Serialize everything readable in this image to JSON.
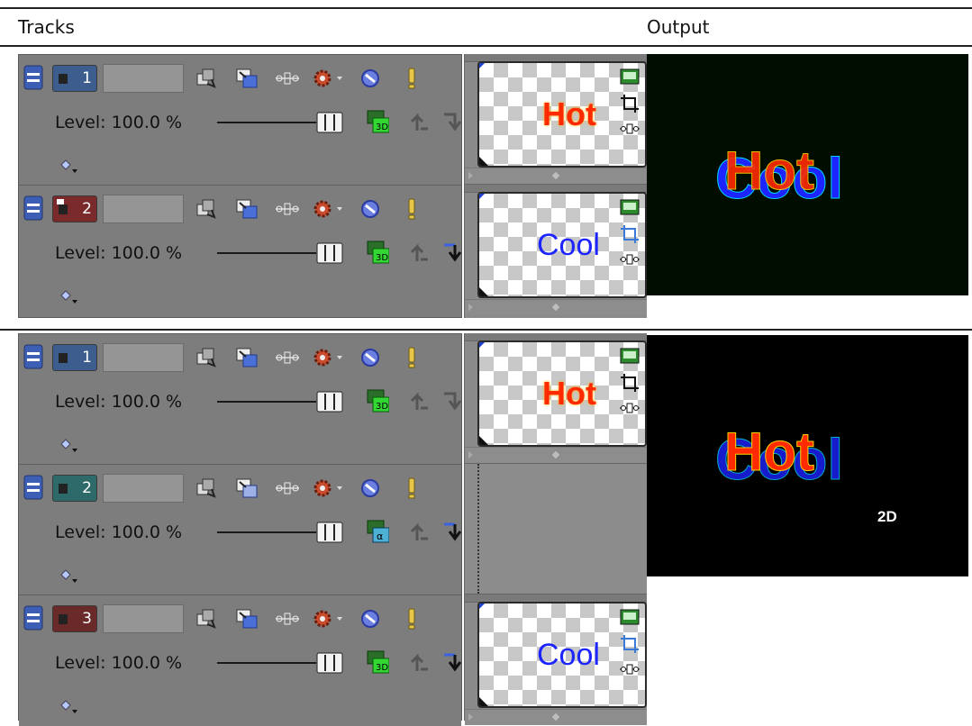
{
  "header": {
    "tracks_label": "Tracks",
    "output_label": "Output"
  },
  "level_text": "Level: 100.0 %",
  "group1": {
    "tracks": [
      {
        "number": "1",
        "color": "#3d5d8f",
        "mode_icon": "stereo-3d-icon"
      },
      {
        "number": "2",
        "color": "#7a2a2a",
        "mode_icon": "stereo-3d-icon"
      }
    ],
    "events": [
      {
        "label": "Hot",
        "label_color": "#ff2a00"
      },
      {
        "label": "Cool",
        "label_color": "#1c24ff"
      }
    ],
    "output": {
      "main_text": "Hot",
      "back_text": "Cool"
    }
  },
  "group2": {
    "tracks": [
      {
        "number": "1",
        "color": "#3d5d8f",
        "mode_icon": "stereo-3d-icon"
      },
      {
        "number": "2",
        "color": "#2f6a6a",
        "mode_icon": "alpha-icon"
      },
      {
        "number": "3",
        "color": "#6a2a2a",
        "mode_icon": "stereo-3d-icon"
      }
    ],
    "events": [
      {
        "label": "Hot",
        "label_color": "#ff2a00"
      },
      {
        "label": "",
        "label_color": ""
      },
      {
        "label": "Cool",
        "label_color": "#1c24ff"
      }
    ],
    "output": {
      "main_text": "Hot",
      "back_text": "Cool",
      "badge": "2D"
    }
  },
  "icons": [
    "collapse-icon",
    "track-motion-icon",
    "composite-mode-icon",
    "bypass-motion-blur-icon",
    "track-fx-icon",
    "mute-icon",
    "solo-icon",
    "keyframe-icon",
    "make-compositing-child-icon",
    "make-compositing-parent-icon"
  ]
}
